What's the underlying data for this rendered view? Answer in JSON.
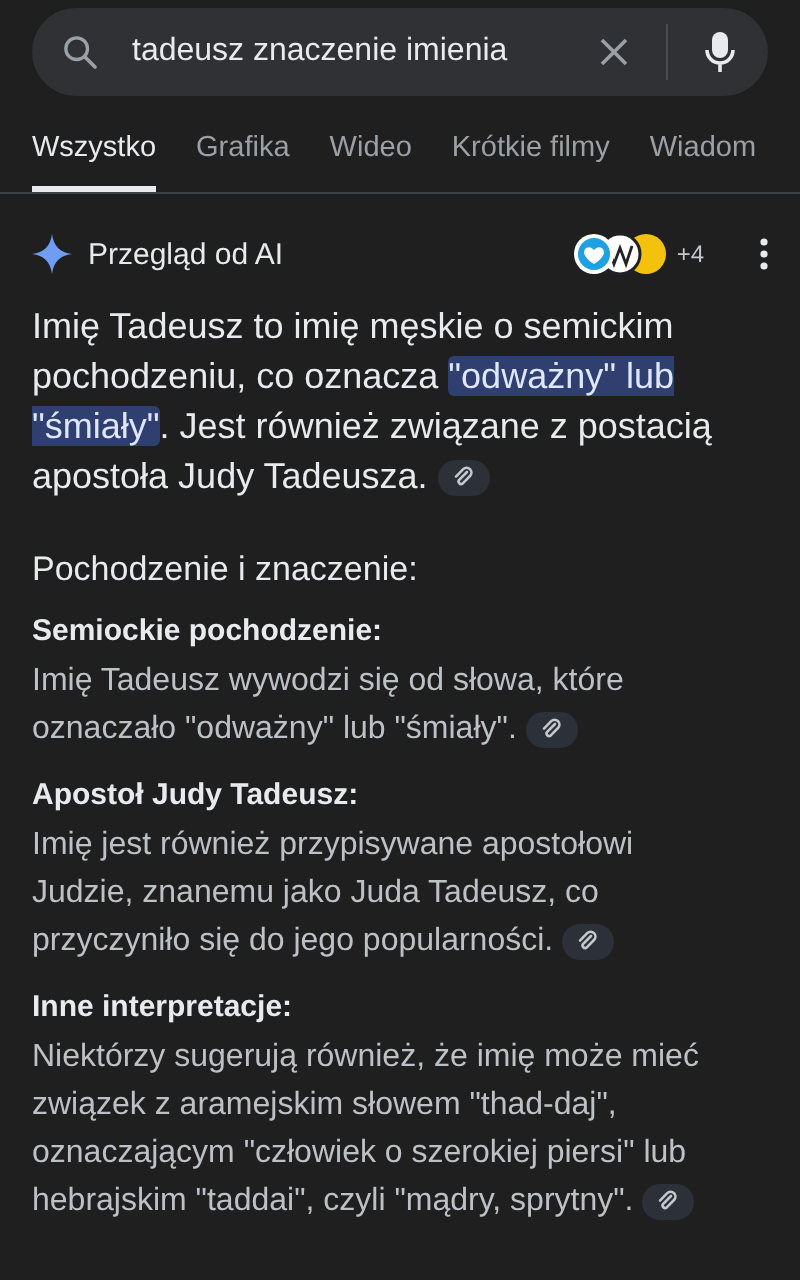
{
  "search": {
    "value": "tadeusz znaczenie imienia"
  },
  "tabs": [
    {
      "label": "Wszystko",
      "selected": true
    },
    {
      "label": "Grafika",
      "selected": false
    },
    {
      "label": "Wideo",
      "selected": false
    },
    {
      "label": "Krótkie filmy",
      "selected": false
    },
    {
      "label": "Wiadom",
      "selected": false
    }
  ],
  "ai_overview": {
    "title": "Przegląd od AI",
    "sources_more": "+4",
    "intro": [
      {
        "text": "Imię Tadeusz to imię męskie o semickim pochodzeniu, co oznacza ",
        "highlighted": false
      },
      {
        "text": "\"odważny\" lub \"śmiały\"",
        "highlighted": true
      },
      {
        "text": ". Jest również związane z postacią apostoła Judy Tadeusza.",
        "highlighted": false
      }
    ],
    "heading": "Pochodzenie i znaczenie:",
    "sections": [
      {
        "title": "Semiockie pochodzenie:",
        "body": "Imię Tadeusz wywodzi się od słowa, które oznaczało \"odważny\" lub \"śmiały\"."
      },
      {
        "title": "Apostoł Judy Tadeusz:",
        "body": "Imię jest również przypisywane apostołowi Judzie, znanemu jako Juda Tadeusz, co przyczyniło się do jego popularności."
      },
      {
        "title": "Inne interpretacje:",
        "body": "Niektórzy sugerują również, że imię może mieć związek z aramejskim słowem \"thad-daj\", oznaczającym \"człowiek o szerokiej piersi\" lub hebrajskim \"taddai\", czyli \"mądry, sprytny\"."
      }
    ]
  }
}
